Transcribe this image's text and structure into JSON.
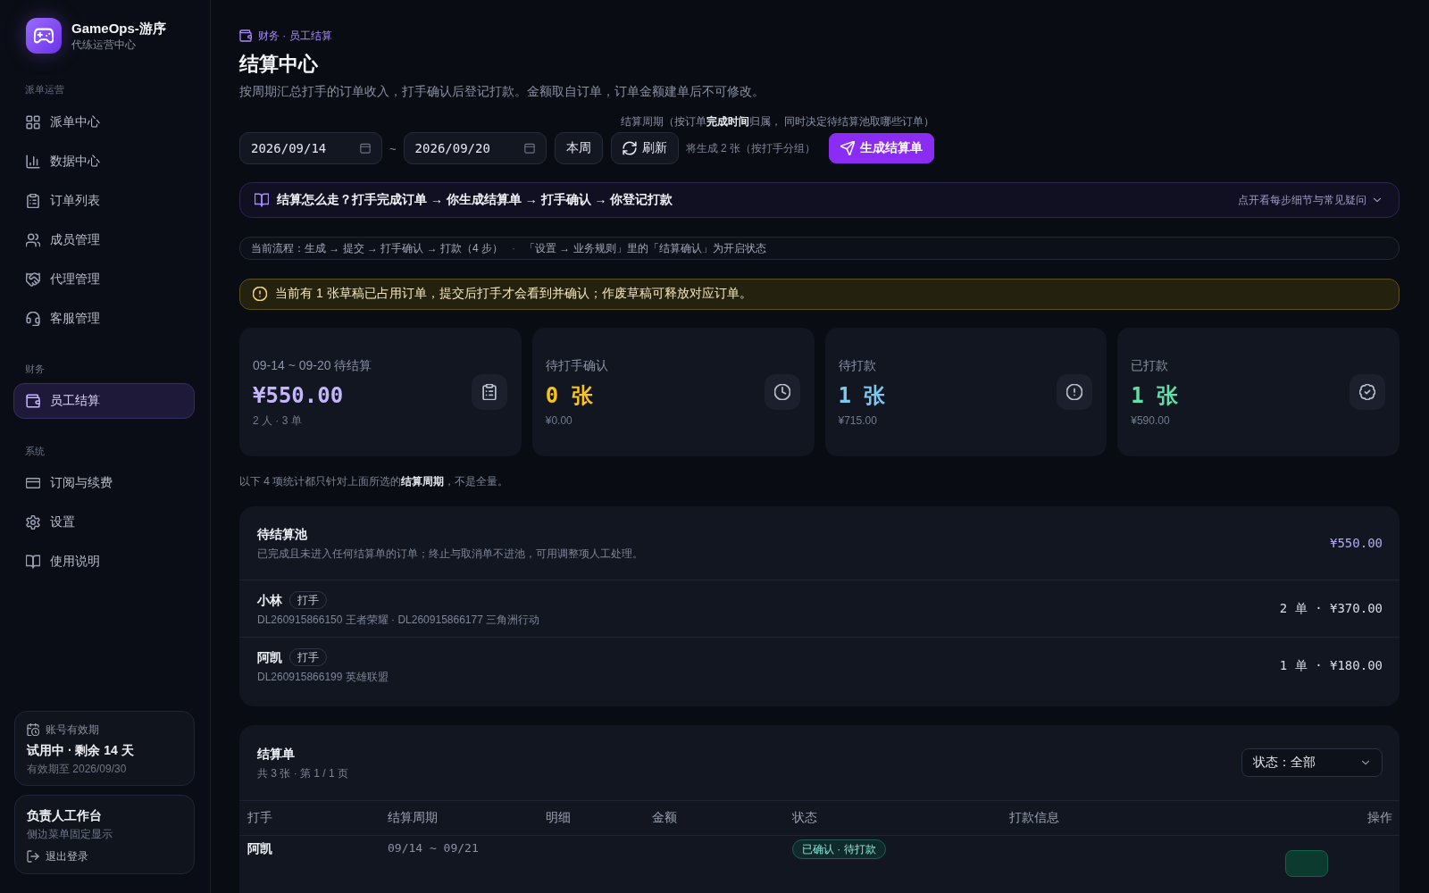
{
  "sidebar": {
    "brand": {
      "title": "GameOps-游序",
      "subtitle": "代练运营中心"
    },
    "sections": [
      {
        "label": "派单运营",
        "items": [
          {
            "label": "派单中心",
            "selected": false
          },
          {
            "label": "数据中心",
            "selected": false
          },
          {
            "label": "订单列表",
            "selected": false
          },
          {
            "label": "成员管理",
            "selected": false
          },
          {
            "label": "代理管理",
            "selected": false
          },
          {
            "label": "客服管理",
            "selected": false
          }
        ]
      },
      {
        "label": "财务",
        "items": [
          {
            "label": "员工结算",
            "selected": true
          }
        ]
      },
      {
        "label": "系统",
        "items": [
          {
            "label": "订阅与续费",
            "selected": false
          },
          {
            "label": "设置",
            "selected": false
          },
          {
            "label": "使用说明",
            "selected": false
          }
        ]
      }
    ],
    "account_card": {
      "label": "账号有效期",
      "status": "试用中 · 剩余 14 天",
      "expiry": "有效期至 2026/09/30"
    },
    "workspace_card": {
      "title": "负责人工作台",
      "subtitle": "侧边菜单固定显示",
      "logout": "退出登录"
    }
  },
  "header": {
    "breadcrumb": "财务 · 员工结算",
    "title": "结算中心",
    "description": "按周期汇总打手的订单收入，打手确认后登记打款。金额取自订单，订单金额建单后不可修改。"
  },
  "toolbar": {
    "hint": "结算周期（按订单**完成时间**归属， 同时决定待结算池取哪些订单）",
    "start_date": "2026/09/14",
    "separator": "~",
    "end_date": "2026/09/20",
    "this_week": "本周",
    "refresh": "刷新",
    "preview": "将生成 2 张（按打手分组）",
    "generate": "生成结算单"
  },
  "guide": {
    "text": "结算怎么走？打手完成订单 → 你生成结算单 → 打手确认 → 你登记打款",
    "toggle": "点开看每步细节与常见疑问",
    "expanded": false
  },
  "flow": {
    "steps": "当前流程：生成 → 提交 → 打手确认 → 打款（4 步）",
    "separator": "·",
    "note": "「设置 → 业务规则」里的「结算确认」为开启状态"
  },
  "alert": {
    "text": "当前有 1 张草稿已占用订单，提交后打手才会看到并确认；作废草稿可释放对应订单。"
  },
  "stats": [
    {
      "label": "09-14 ~ 09-20 待结算",
      "value": "¥550.00",
      "sub": "2 人 · 3 单",
      "color": "#c4b5fd"
    },
    {
      "label": "待打手确认",
      "value": "0 张",
      "sub": "¥0.00",
      "color": "#fcc419"
    },
    {
      "label": "待打款",
      "value": "1 张",
      "sub": "¥715.00",
      "color": "#7cc8f0"
    },
    {
      "label": "已打款",
      "value": "1 张",
      "sub": "¥590.00",
      "color": "#5fe0a6"
    }
  ],
  "stats_note": "以下 4 项统计都只针对上面所选的**结算周期**，不是全量。",
  "pool": {
    "title": "待结算池",
    "description": "已完成且未进入任何结算单的订单；终止与取消单不进池，可用调整项人工处理。",
    "total": "¥550.00",
    "rows": [
      {
        "name": "小林",
        "role": "打手",
        "orders": "DL260915866150 王者荣耀 · DL260915866177 三角洲行动",
        "summary": "2 单 · ¥370.00"
      },
      {
        "name": "阿凯",
        "role": "打手",
        "orders": "DL260915866199 英雄联盟",
        "summary": "1 单 · ¥180.00"
      }
    ]
  },
  "settlements": {
    "title": "结算单",
    "count": "共 3 张 · 第 1 / 1 页",
    "filter": "状态：全部",
    "columns": [
      "打手",
      "结算周期",
      "明细",
      "金额",
      "状态",
      "打款信息",
      "操作"
    ],
    "rows": [
      {
        "player": "阿凯",
        "period": "09/14 ~ 09/21",
        "status": "已确认 · 待打款"
      }
    ]
  }
}
